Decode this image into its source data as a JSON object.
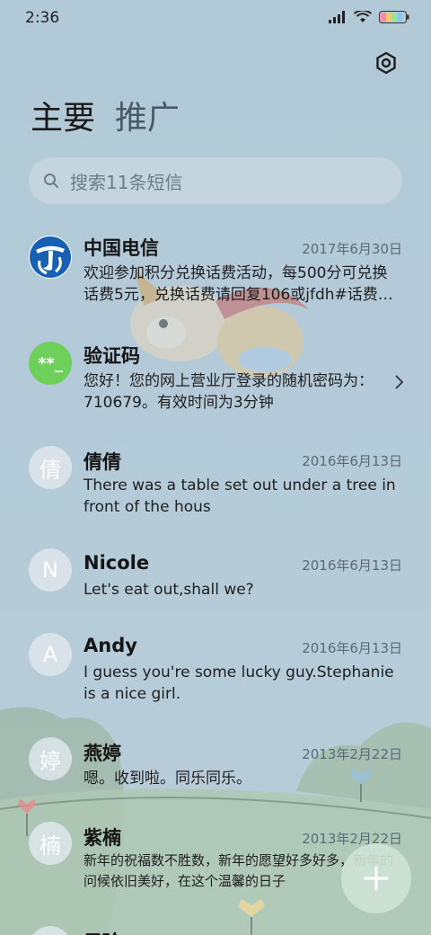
{
  "status": {
    "time": "2:36"
  },
  "tabs": [
    {
      "label": "主要"
    },
    {
      "label": "推广"
    }
  ],
  "search": {
    "placeholder": "搜索11条短信"
  },
  "messages": [
    {
      "name": "中国电信",
      "date": "2017年6月30日",
      "preview": "欢迎参加积分兑换话费活动，每500分可兑换话费5元，兑换话费请回复106或jfdh#话费…",
      "avatar_text": ""
    },
    {
      "name": "验证码",
      "date": "",
      "preview": "您好！您的网上营业厅登录的随机密码为：710679。有效时间为3分钟",
      "avatar_text": "**_"
    },
    {
      "name": "倩倩",
      "date": "2016年6月13日",
      "preview": "There was a table set out under a tree in front of the hous",
      "avatar_text": "倩"
    },
    {
      "name": "Nicole",
      "date": "2016年6月13日",
      "preview": "Let's eat out,shall we?",
      "avatar_text": "N"
    },
    {
      "name": "Andy",
      "date": "2016年6月13日",
      "preview": "I guess you're some lucky guy.Stephanie is a nice girl.",
      "avatar_text": "A"
    },
    {
      "name": "燕婷",
      "date": "2013年2月22日",
      "preview": "嗯。收到啦。同乐同乐。",
      "avatar_text": "婷"
    },
    {
      "name": "紫楠",
      "date": "2013年2月22日",
      "preview": "新年的祝福数不胜数，新年的愿望好多好多，新年的问候依旧美好，在这个温馨的日子",
      "avatar_text": "楠"
    },
    {
      "name": "子玲",
      "date": "",
      "preview": "",
      "avatar_text": ""
    }
  ],
  "colors": {
    "verify_avatar": "#6cd05a",
    "telecom_blue": "#1760b4",
    "fab_bg": "#cee2d6"
  }
}
